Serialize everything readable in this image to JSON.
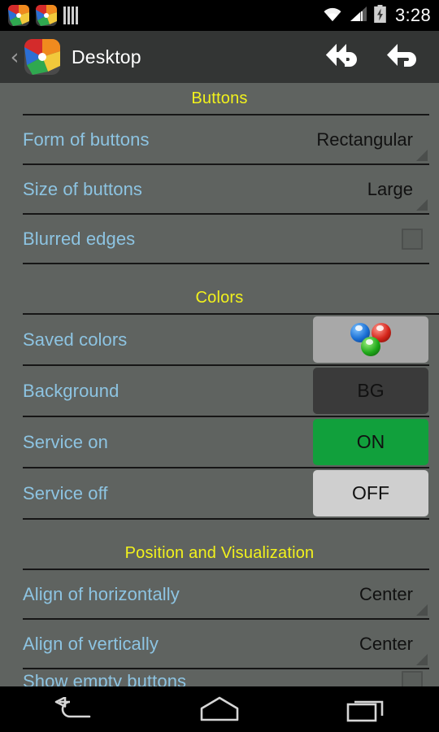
{
  "status_bar": {
    "time": "3:28",
    "notification_icons": [
      "app-pinwheel-icon",
      "app-pinwheel-icon",
      "bars-icon"
    ],
    "system_icons": [
      "wifi-icon",
      "cellular-signal-icon",
      "battery-charging-icon"
    ]
  },
  "action_bar": {
    "up_caret": "‹",
    "title": "Desktop",
    "app_icon": "app-pinwheel-icon",
    "actions": [
      {
        "name": "undo-all-button",
        "icon": "double-back-arrow-icon"
      },
      {
        "name": "undo-button",
        "icon": "back-arrow-icon"
      }
    ]
  },
  "sections": [
    {
      "title": "Buttons",
      "rows": [
        {
          "label": "Form of buttons",
          "type": "spinner",
          "value": "Rectangular"
        },
        {
          "label": "Size of buttons",
          "type": "spinner",
          "value": "Large"
        },
        {
          "label": "Blurred edges",
          "type": "checkbox",
          "checked": false
        }
      ]
    },
    {
      "title": "Colors",
      "rows": [
        {
          "label": "Saved colors",
          "type": "color",
          "style": "saved",
          "value": "",
          "swatch": "three-spheres-icon"
        },
        {
          "label": "Background",
          "type": "color",
          "style": "bg",
          "value": "BG"
        },
        {
          "label": "Service on",
          "type": "color",
          "style": "on",
          "value": "ON"
        },
        {
          "label": "Service off",
          "type": "color",
          "style": "off",
          "value": "OFF"
        }
      ]
    },
    {
      "title": "Position and Visualization",
      "rows": [
        {
          "label": "Align of horizontally",
          "type": "spinner",
          "value": "Center"
        },
        {
          "label": "Align of vertically",
          "type": "spinner",
          "value": "Center"
        },
        {
          "label": "Show empty buttons",
          "type": "checkbox",
          "checked": false,
          "clipped": true
        }
      ]
    }
  ],
  "nav_bar": {
    "buttons": [
      {
        "name": "nav-back-button",
        "icon": "back-arrow-icon"
      },
      {
        "name": "nav-home-button",
        "icon": "home-icon"
      },
      {
        "name": "nav-recents-button",
        "icon": "recents-icon"
      }
    ]
  },
  "colors": {
    "background": "#5f6360",
    "label": "#8dc4e2",
    "section_title": "#f2f21c",
    "action_bar": "#333534",
    "service_on": "#11a03c",
    "service_off": "#cfcfcf",
    "bg_button": "#3a3a3a",
    "saved_button": "#a8a8a8"
  }
}
